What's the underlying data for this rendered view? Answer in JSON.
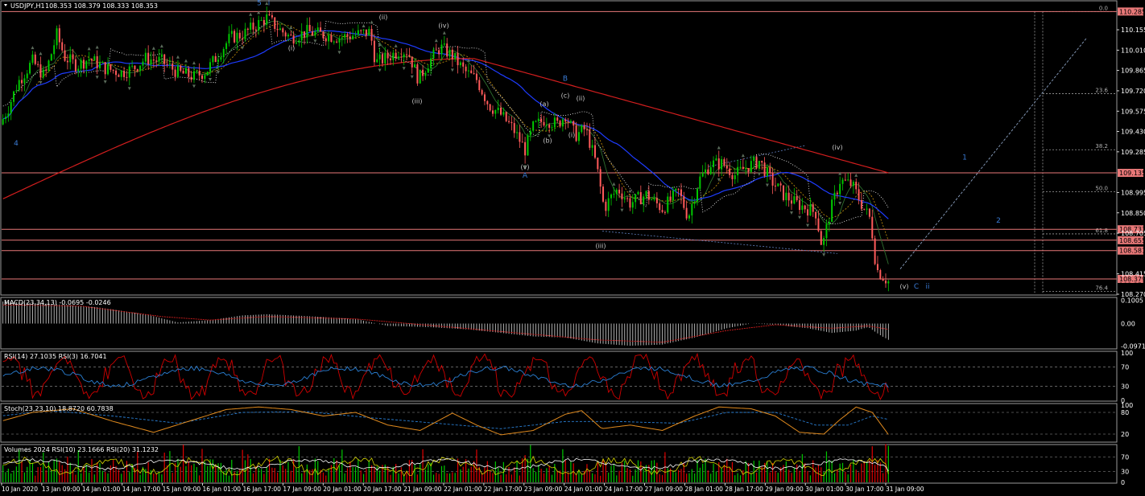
{
  "window": {
    "symbol_title": "USDJPY,H1",
    "ohlc": "108.353 108.379 108.333 108.353"
  },
  "colors": {
    "bull": "#00c800",
    "bear": "#ff5a5a",
    "ma_fast": "#2f6f2f",
    "ma_slow": "#b8860b",
    "ma_blue": "#1e3cff",
    "ma_red": "#d21e1e",
    "hline": "#e87878",
    "badge": "#e87878",
    "border": "#9a9a9a",
    "rsi14": "#d00000",
    "rsi3": "#2a7fd4",
    "stoch_main": "#e08a1e",
    "stoch_signal": "#2a7fd4",
    "vol_bull": "#00c800",
    "vol_bear": "#e00000"
  },
  "chart_data": [
    {
      "type": "candlestick",
      "panel": "price",
      "ylim": [
        108.27,
        110.35
      ],
      "y_ticks": [
        "110.155",
        "110.010",
        "109.865",
        "109.720",
        "109.575",
        "109.430",
        "109.285",
        "108.995",
        "108.850",
        "108.705",
        "108.415",
        "108.270"
      ],
      "y_tick_values": [
        110.155,
        110.01,
        109.865,
        109.72,
        109.575,
        109.43,
        109.285,
        108.995,
        108.85,
        108.705,
        108.415,
        108.27
      ],
      "price_key_points": [
        [
          0,
          109.48
        ],
        [
          10,
          109.6
        ],
        [
          22,
          109.78
        ],
        [
          40,
          109.93
        ],
        [
          55,
          109.82
        ],
        [
          70,
          110.12
        ],
        [
          80,
          109.96
        ],
        [
          95,
          109.9
        ],
        [
          110,
          109.95
        ],
        [
          130,
          109.88
        ],
        [
          150,
          109.85
        ],
        [
          165,
          109.88
        ],
        [
          180,
          109.95
        ],
        [
          200,
          109.93
        ],
        [
          220,
          109.85
        ],
        [
          240,
          109.82
        ],
        [
          255,
          109.86
        ],
        [
          270,
          109.98
        ],
        [
          285,
          110.1
        ],
        [
          300,
          110.12
        ],
        [
          315,
          110.18
        ],
        [
          330,
          110.24
        ],
        [
          345,
          110.16
        ],
        [
          360,
          110.1
        ],
        [
          380,
          110.14
        ],
        [
          400,
          110.12
        ],
        [
          420,
          110.1
        ],
        [
          440,
          110.12
        ],
        [
          458,
          110.14
        ],
        [
          465,
          109.92
        ],
        [
          480,
          109.96
        ],
        [
          495,
          110.01
        ],
        [
          505,
          110.0
        ],
        [
          518,
          109.8
        ],
        [
          530,
          109.92
        ],
        [
          545,
          110.03
        ],
        [
          560,
          109.97
        ],
        [
          575,
          109.86
        ],
        [
          590,
          109.8
        ],
        [
          605,
          109.62
        ],
        [
          620,
          109.55
        ],
        [
          635,
          109.45
        ],
        [
          650,
          109.3
        ],
        [
          660,
          109.46
        ],
        [
          675,
          109.52
        ],
        [
          690,
          109.48
        ],
        [
          700,
          109.55
        ],
        [
          712,
          109.4
        ],
        [
          725,
          109.45
        ],
        [
          738,
          109.2
        ],
        [
          748,
          108.88
        ],
        [
          755,
          108.95
        ],
        [
          765,
          109.02
        ],
        [
          780,
          108.92
        ],
        [
          800,
          108.98
        ],
        [
          820,
          108.88
        ],
        [
          840,
          109.0
        ],
        [
          852,
          108.82
        ],
        [
          865,
          109.08
        ],
        [
          880,
          109.2
        ],
        [
          895,
          109.2
        ],
        [
          910,
          109.12
        ],
        [
          925,
          109.18
        ],
        [
          940,
          109.22
        ],
        [
          955,
          109.08
        ],
        [
          970,
          108.98
        ],
        [
          985,
          108.92
        ],
        [
          1000,
          108.88
        ],
        [
          1010,
          108.85
        ],
        [
          1018,
          108.6
        ],
        [
          1028,
          108.86
        ],
        [
          1040,
          109.08
        ],
        [
          1055,
          109.05
        ],
        [
          1068,
          108.9
        ],
        [
          1078,
          108.8
        ],
        [
          1085,
          108.45
        ],
        [
          1093,
          108.4
        ],
        [
          1100,
          108.36
        ]
      ],
      "horizontal_levels": [
        {
          "label": "110.285",
          "value": 110.285
        },
        {
          "label": "109.135",
          "value": 109.135
        },
        {
          "label": "108.733",
          "value": 108.733
        },
        {
          "label": "108.655",
          "value": 108.655
        },
        {
          "label": "108.581",
          "value": 108.581
        },
        {
          "label": "108.379",
          "value": 108.379
        }
      ],
      "extra_axis_text": "108.353",
      "fib_levels": [
        {
          "label": "0.0",
          "value": 110.285
        },
        {
          "label": "23.6",
          "value": 109.7
        },
        {
          "label": "38.2",
          "value": 109.3
        },
        {
          "label": "50.0",
          "value": 109.0
        },
        {
          "label": "61.8",
          "value": 108.7
        },
        {
          "label": "76.4",
          "value": 108.29
        }
      ],
      "wave_labels": [
        {
          "text": "4",
          "x": 20,
          "value": 109.33,
          "style": "blue"
        },
        {
          "text": "5",
          "x": 322,
          "value": 110.33,
          "style": "blue"
        },
        {
          "text": "i",
          "x": 334,
          "value": 110.33,
          "style": "blue"
        },
        {
          "text": "(i)",
          "x": 362,
          "value": 110.01,
          "style": "grey"
        },
        {
          "text": "(ii)",
          "x": 476,
          "value": 110.23,
          "style": "grey"
        },
        {
          "text": "(iv)",
          "x": 551,
          "value": 110.17,
          "style": "grey"
        },
        {
          "text": "(iii)",
          "x": 518,
          "value": 109.63,
          "style": "grey"
        },
        {
          "text": "B",
          "x": 702,
          "value": 109.79,
          "style": "blue"
        },
        {
          "text": "(c)",
          "x": 702,
          "value": 109.67,
          "style": "grey"
        },
        {
          "text": "(ii)",
          "x": 721,
          "value": 109.65,
          "style": "grey"
        },
        {
          "text": "(a)",
          "x": 676,
          "value": 109.61,
          "style": "grey"
        },
        {
          "text": "(i)",
          "x": 710,
          "value": 109.39,
          "style": "grey"
        },
        {
          "text": "(b)",
          "x": 680,
          "value": 109.35,
          "style": "grey"
        },
        {
          "text": "(v)",
          "x": 652,
          "value": 109.16,
          "style": "grey"
        },
        {
          "text": "A",
          "x": 652,
          "value": 109.1,
          "style": "blue"
        },
        {
          "text": "(iii)",
          "x": 746,
          "value": 108.6,
          "style": "grey"
        },
        {
          "text": "(iv)",
          "x": 1040,
          "value": 109.3,
          "style": "grey"
        },
        {
          "text": "1",
          "x": 1198,
          "value": 109.23,
          "style": "blue"
        },
        {
          "text": "2",
          "x": 1240,
          "value": 108.78,
          "style": "blue"
        },
        {
          "text": "(v)",
          "x": 1123,
          "value": 108.31,
          "style": "grey"
        },
        {
          "text": "C",
          "x": 1138,
          "value": 108.31,
          "style": "blue"
        },
        {
          "text": "ii",
          "x": 1152,
          "value": 108.31,
          "style": "blue"
        }
      ]
    },
    {
      "type": "bar",
      "panel": "macd",
      "title": "MACD(23,34,13) -0.0695 -0.0246",
      "y_ticks": [
        "0.1005",
        "0.00",
        "-0.0971"
      ],
      "y_tick_values": [
        0.1005,
        0.0,
        -0.0971
      ],
      "macd_key_points": [
        [
          0,
          0.095
        ],
        [
          60,
          0.085
        ],
        [
          120,
          0.07
        ],
        [
          180,
          0.04
        ],
        [
          220,
          0.005
        ],
        [
          260,
          0.015
        ],
        [
          300,
          0.035
        ],
        [
          330,
          0.04
        ],
        [
          380,
          0.032
        ],
        [
          440,
          0.02
        ],
        [
          480,
          -0.01
        ],
        [
          530,
          -0.015
        ],
        [
          580,
          -0.025
        ],
        [
          620,
          -0.04
        ],
        [
          660,
          -0.055
        ],
        [
          700,
          -0.06
        ],
        [
          740,
          -0.085
        ],
        [
          780,
          -0.095
        ],
        [
          820,
          -0.09
        ],
        [
          860,
          -0.06
        ],
        [
          900,
          -0.02
        ],
        [
          930,
          0.0
        ],
        [
          960,
          -0.005
        ],
        [
          1000,
          -0.02
        ],
        [
          1030,
          -0.04
        ],
        [
          1060,
          -0.03
        ],
        [
          1075,
          -0.015
        ],
        [
          1090,
          -0.05
        ],
        [
          1100,
          -0.0695
        ]
      ],
      "signal_key_points": [
        [
          0,
          0.08
        ],
        [
          100,
          0.075
        ],
        [
          200,
          0.03
        ],
        [
          260,
          0.015
        ],
        [
          330,
          0.03
        ],
        [
          440,
          0.02
        ],
        [
          540,
          -0.01
        ],
        [
          640,
          -0.04
        ],
        [
          740,
          -0.07
        ],
        [
          820,
          -0.08
        ],
        [
          900,
          -0.03
        ],
        [
          960,
          -0.005
        ],
        [
          1030,
          -0.02
        ],
        [
          1075,
          -0.01
        ],
        [
          1100,
          -0.0246
        ]
      ]
    },
    {
      "type": "line",
      "panel": "rsi",
      "title": "RSI(14) 27.1035  RSI(3) 16.7041",
      "y_ticks": [
        "100",
        "70",
        "30",
        "0"
      ],
      "y_tick_values": [
        100,
        70,
        30,
        0
      ],
      "ylim": [
        0,
        100
      ],
      "series": [
        {
          "name": "RSI(14)",
          "last": 27.1035
        },
        {
          "name": "RSI(3)",
          "last": 16.7041
        }
      ]
    },
    {
      "type": "line",
      "panel": "stoch",
      "title": "Stoch(23,23,10) 18.8720 60.7838",
      "y_ticks": [
        "100",
        "80",
        "20"
      ],
      "y_tick_values": [
        100,
        80,
        20
      ],
      "ylim": [
        0,
        100
      ],
      "stoch_key_points": [
        [
          0,
          55
        ],
        [
          40,
          80
        ],
        [
          90,
          90
        ],
        [
          140,
          55
        ],
        [
          190,
          25
        ],
        [
          240,
          60
        ],
        [
          280,
          88
        ],
        [
          320,
          95
        ],
        [
          360,
          88
        ],
        [
          400,
          70
        ],
        [
          440,
          80
        ],
        [
          480,
          45
        ],
        [
          520,
          30
        ],
        [
          560,
          78
        ],
        [
          590,
          45
        ],
        [
          620,
          18
        ],
        [
          660,
          30
        ],
        [
          700,
          75
        ],
        [
          720,
          85
        ],
        [
          745,
          35
        ],
        [
          780,
          45
        ],
        [
          820,
          30
        ],
        [
          860,
          70
        ],
        [
          890,
          95
        ],
        [
          930,
          90
        ],
        [
          960,
          70
        ],
        [
          990,
          25
        ],
        [
          1020,
          20
        ],
        [
          1040,
          60
        ],
        [
          1060,
          95
        ],
        [
          1080,
          80
        ],
        [
          1100,
          18.872
        ]
      ],
      "signal_key_points": [
        [
          0,
          70
        ],
        [
          60,
          85
        ],
        [
          140,
          70
        ],
        [
          220,
          50
        ],
        [
          300,
          80
        ],
        [
          380,
          82
        ],
        [
          460,
          65
        ],
        [
          540,
          50
        ],
        [
          620,
          35
        ],
        [
          700,
          55
        ],
        [
          760,
          55
        ],
        [
          840,
          50
        ],
        [
          900,
          80
        ],
        [
          960,
          80
        ],
        [
          1010,
          45
        ],
        [
          1050,
          45
        ],
        [
          1080,
          70
        ],
        [
          1100,
          60.7838
        ]
      ]
    },
    {
      "type": "bar",
      "panel": "volumes",
      "title": "Volumes 2024  RSI(10) 23.1666  RSI(20) 31.1232",
      "y_ticks": [
        "9034",
        "70",
        "30",
        "0"
      ],
      "y_tick_values": [
        9034,
        70,
        30,
        0
      ],
      "volume_last": 2024,
      "series": [
        {
          "name": "RSI(10)",
          "last": 23.1666
        },
        {
          "name": "RSI(20)",
          "last": 31.1232
        }
      ]
    }
  ],
  "x_axis": {
    "labels": [
      "10 Jan 2020",
      "13 Jan 09:00",
      "14 Jan 01:00",
      "14 Jan 17:00",
      "15 Jan 09:00",
      "16 Jan 01:00",
      "16 Jan 17:00",
      "17 Jan 09:00",
      "20 Jan 01:00",
      "20 Jan 17:00",
      "21 Jan 09:00",
      "22 Jan 01:00",
      "22 Jan 17:00",
      "23 Jan 09:00",
      "24 Jan 01:00",
      "24 Jan 17:00",
      "27 Jan 09:00",
      "28 Jan 01:00",
      "28 Jan 17:00",
      "29 Jan 09:00",
      "30 Jan 01:00",
      "30 Jan 17:00",
      "31 Jan 09:00"
    ]
  }
}
